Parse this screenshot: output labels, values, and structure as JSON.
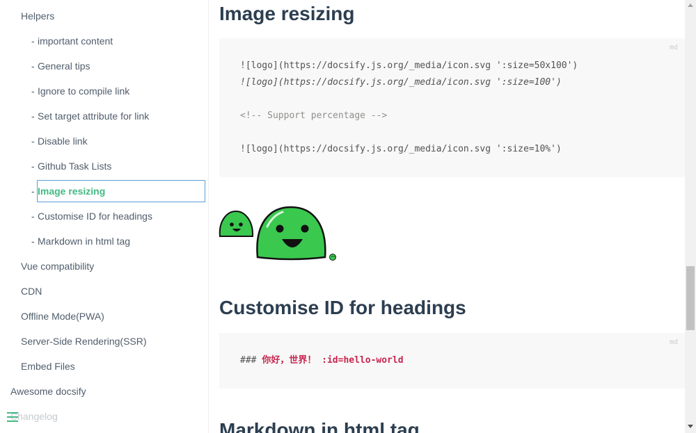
{
  "sidebar": {
    "helpers": "Helpers",
    "sub_items": [
      "important content",
      "General tips",
      "Ignore to compile link",
      "Set target attribute for link",
      "Disable link",
      "Github Task Lists",
      "Image resizing",
      "Customise ID for headings",
      "Markdown in html tag"
    ],
    "dash": "-",
    "items": [
      "Vue compatibility",
      "CDN",
      "Offline Mode(PWA)",
      "Server-Side Rendering(SSR)",
      "Embed Files"
    ],
    "top_items": [
      "Awesome docsify",
      "Changelog"
    ],
    "menu_icon": "hamburger-icon",
    "accent": "#42b983"
  },
  "main": {
    "h_image_resizing": "Image resizing",
    "code1": {
      "lang": "md",
      "line1": "![logo](https://docsify.js.org/_media/icon.svg ':size=50x100')",
      "line2": "![logo](https://docsify.js.org/_media/icon.svg ':size=100')",
      "line3": "<!-- Support percentage -->",
      "line4": "![logo](https://docsify.js.org/_media/icon.svg ':size=10%')"
    },
    "h_custom_id": "Customise ID for headings",
    "code2": {
      "lang": "md",
      "prefix": "### ",
      "text": "你好，世界！ :id=hello-world"
    },
    "h_markdown_html": "Markdown in html tag"
  },
  "colors": {
    "heading": "#2c3e50",
    "logo_green": "#3ac84f",
    "code_bg": "#f8f8f8"
  }
}
